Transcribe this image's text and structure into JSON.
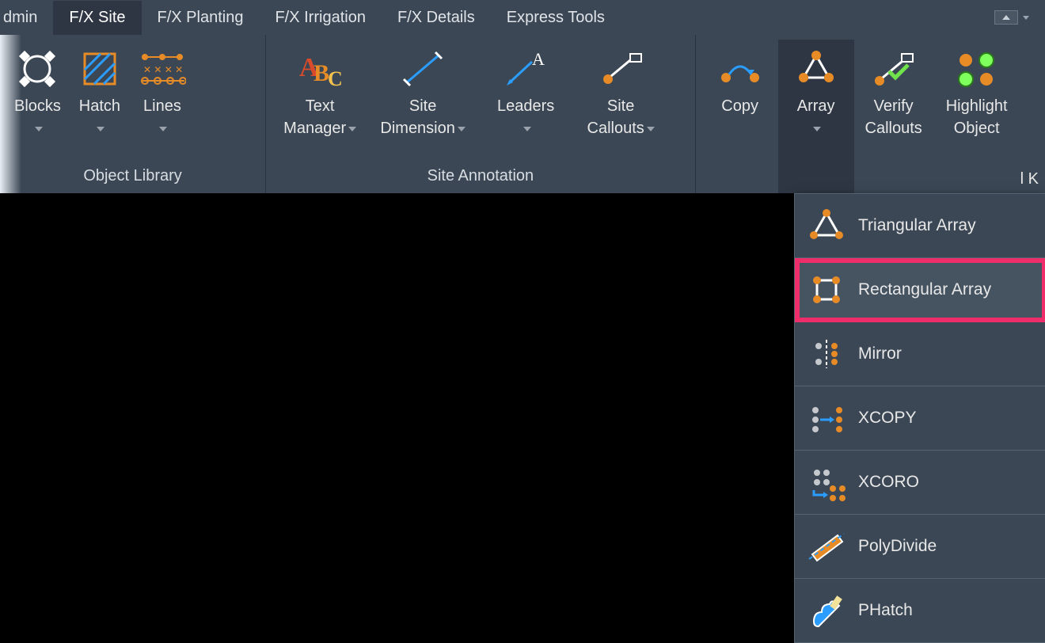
{
  "tabs": {
    "partial": "dmin",
    "items": [
      "F/X Site",
      "F/X Planting",
      "F/X Irrigation",
      "F/X Details",
      "Express Tools"
    ],
    "active_index": 0
  },
  "panels": {
    "object_library": {
      "title": "Object Library",
      "blocks": "Blocks",
      "hatch": "Hatch",
      "lines": "Lines"
    },
    "site_annotation": {
      "title": "Site Annotation",
      "text_manager_l1": "Text",
      "text_manager_l2": "Manager",
      "site_dimension_l1": "Site",
      "site_dimension_l2": "Dimension",
      "leaders": "Leaders",
      "site_callouts_l1": "Site",
      "site_callouts_l2": "Callouts"
    },
    "tools": {
      "copy": "Copy",
      "array": "Array",
      "verify_l1": "Verify",
      "verify_l2": "Callouts",
      "highlight_l1": "Highlight",
      "highlight_l2": "Object",
      "tail": "l K"
    }
  },
  "dropdown": {
    "triangular": "Triangular Array",
    "rectangular": "Rectangular Array",
    "mirror": "Mirror",
    "xcopy": "XCOPY",
    "xcoro": "XCORO",
    "polydivide": "PolyDivide",
    "phatch": "PHatch"
  },
  "colors": {
    "orange": "#e78b27",
    "blue": "#2b9dff",
    "green": "#6fe24c"
  }
}
